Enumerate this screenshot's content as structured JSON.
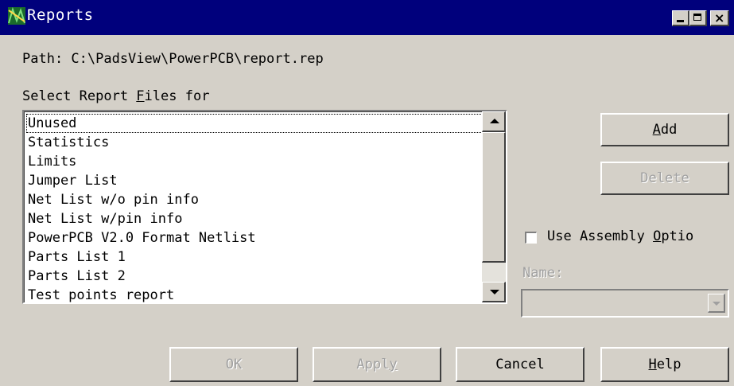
{
  "window": {
    "title": "Reports",
    "minimize_icon": "minimize-icon",
    "maximize_icon": "maximize-icon",
    "close_icon": "close-icon"
  },
  "path_label": "Path: C:\\PadsView\\PowerPCB\\report.rep",
  "select_label": {
    "before": "Select Report ",
    "mnemonic": "F",
    "after": "iles for"
  },
  "report_list": {
    "items": [
      "Unused",
      "Statistics",
      "Limits",
      "Jumper List",
      "Net List w/o pin info",
      "Net List w/pin info",
      "PowerPCB V2.0 Format Netlist",
      "Parts List 1",
      "Parts List 2",
      "Test points report"
    ],
    "focused_index": 0
  },
  "buttons": {
    "add": {
      "mnemonic": "A",
      "rest": "dd",
      "enabled": true
    },
    "delete": {
      "label": "Delete",
      "enabled": false
    },
    "ok": {
      "label": "OK",
      "enabled": false
    },
    "apply": {
      "before": "Appl",
      "mnemonic": "y",
      "after": "",
      "enabled": false
    },
    "cancel": {
      "label": "Cancel",
      "enabled": true
    },
    "help": {
      "mnemonic": "H",
      "rest": "elp",
      "enabled": true
    }
  },
  "assembly_option": {
    "before": "Use Assembly ",
    "mnemonic": "O",
    "after": "ptio",
    "checked": false
  },
  "name_field": {
    "label": "Name:",
    "value": "",
    "enabled": false
  }
}
